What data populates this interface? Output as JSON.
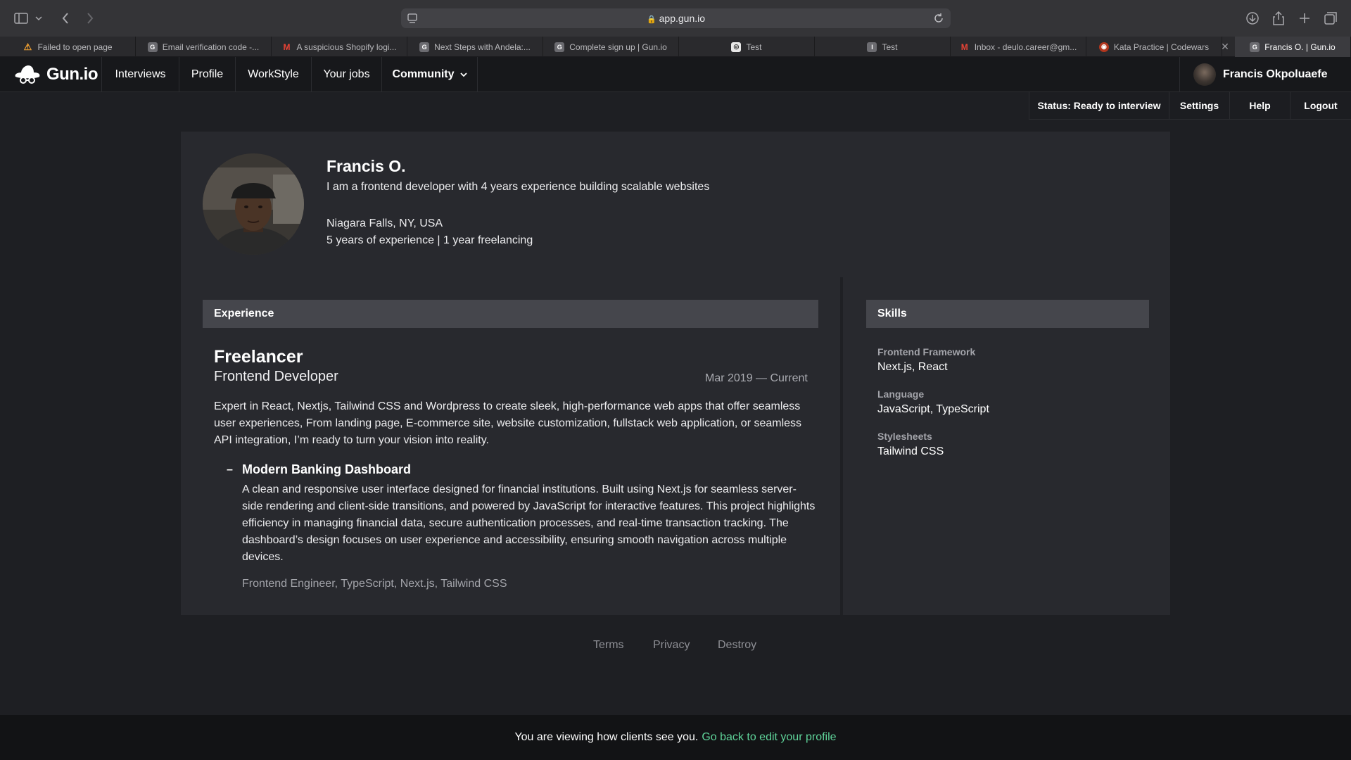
{
  "browser": {
    "url": "app.gun.io",
    "tabs": [
      {
        "title": "Failed to open page",
        "favicon": "warning-icon",
        "active": false
      },
      {
        "title": "Email verification code -...",
        "favicon": "gunio-icon",
        "active": false
      },
      {
        "title": "A suspicious Shopify logi...",
        "favicon": "gmail-icon",
        "active": false
      },
      {
        "title": "Next Steps with Andela:...",
        "favicon": "gunio-icon",
        "active": false
      },
      {
        "title": "Complete sign up | Gun.io",
        "favicon": "gunio-icon",
        "active": false
      },
      {
        "title": "Test",
        "favicon": "target-icon",
        "active": false
      },
      {
        "title": "Test",
        "favicon": "letter-i-icon",
        "active": false
      },
      {
        "title": "Inbox - deulo.career@gm...",
        "favicon": "gmail-icon",
        "active": false
      },
      {
        "title": "Kata Practice | Codewars",
        "favicon": "codewars-icon",
        "active": false
      },
      {
        "title": "Francis O. | Gun.io",
        "favicon": "gunio-icon",
        "active": true
      }
    ]
  },
  "nav": {
    "logo": "Gun.io",
    "items": [
      "Interviews",
      "Profile",
      "WorkStyle",
      "Your jobs"
    ],
    "community": "Community",
    "user_name": "Francis Okpoluaefe"
  },
  "subnav": {
    "status": "Status: Ready to interview",
    "settings": "Settings",
    "help": "Help",
    "logout": "Logout"
  },
  "profile": {
    "name": "Francis O.",
    "tagline": "I am a frontend developer with 4 years experience building scalable websites",
    "location": "Niagara Falls, NY, USA",
    "experience_summary": "5 years of experience | 1 year freelancing"
  },
  "experience": {
    "heading": "Experience",
    "company": "Freelancer",
    "role": "Frontend Developer",
    "dates": "Mar 2019 — Current",
    "description": "Expert in React, Nextjs, Tailwind CSS and Wordpress to create sleek, high-performance web apps that offer seamless user experiences, From landing page, E-commerce site, website customization, fullstack web application, or seamless API integration, I’m ready to turn your vision into reality.",
    "project": {
      "dash": "–",
      "title": "Modern Banking Dashboard",
      "description": "A clean and responsive user interface designed for financial institutions. Built using Next.js for seamless server-side rendering and client-side transitions, and powered by JavaScript for interactive features. This project highlights efficiency in managing financial data, secure authentication processes, and real-time transaction tracking. The dashboard’s design focuses on user experience and accessibility, ensuring smooth navigation across multiple devices.",
      "tags": "Frontend Engineer, TypeScript, Next.js, Tailwind CSS"
    }
  },
  "skills": {
    "heading": "Skills",
    "groups": [
      {
        "label": "Frontend Framework",
        "value": "Next.js, React"
      },
      {
        "label": "Language",
        "value": "JavaScript, TypeScript"
      },
      {
        "label": "Stylesheets",
        "value": "Tailwind CSS"
      }
    ]
  },
  "footer": {
    "terms": "Terms",
    "privacy": "Privacy",
    "destroy": "Destroy"
  },
  "banner": {
    "message": "You are viewing how clients see you.",
    "link": "Go back to edit your profile"
  },
  "colors": {
    "accent": "#5fd49a",
    "card": "#28292e",
    "background": "#1e1f23"
  }
}
